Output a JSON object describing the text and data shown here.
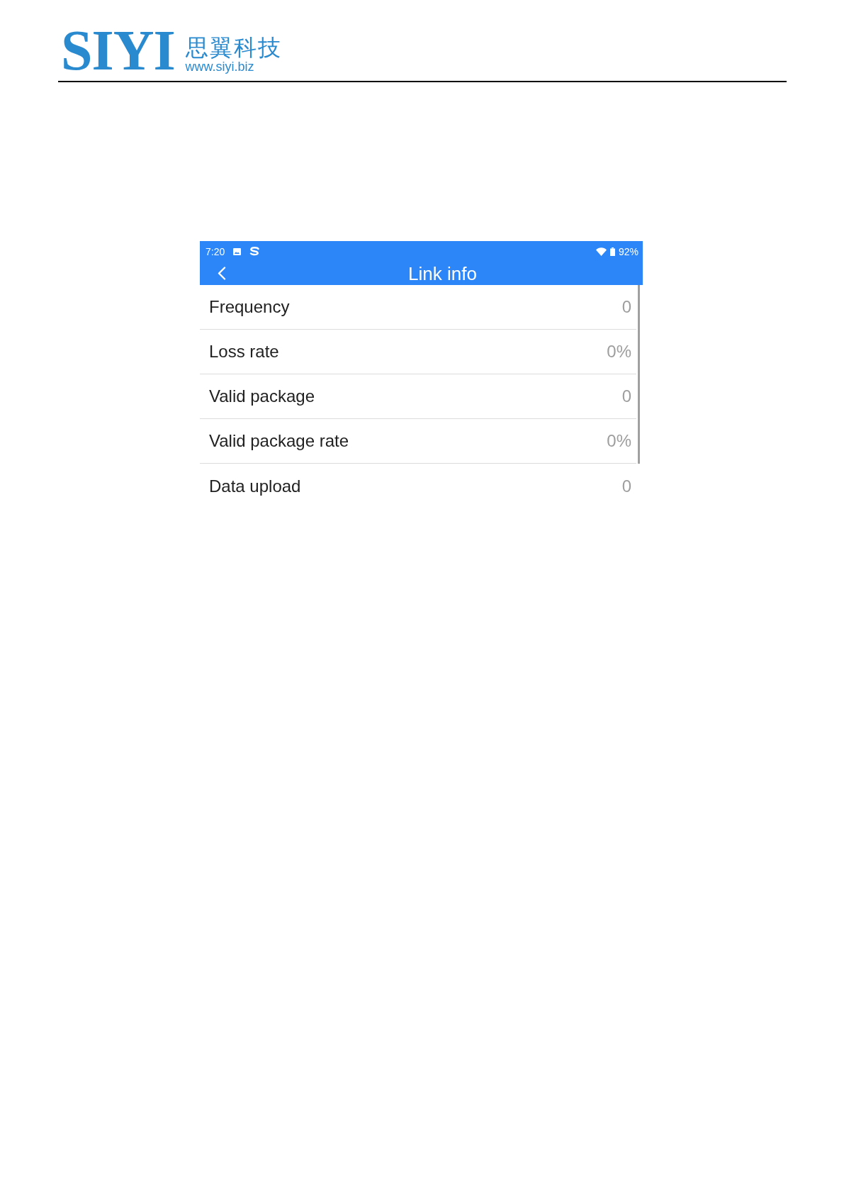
{
  "header": {
    "logo_text": "SIYI",
    "company_name": "思翼科技",
    "website": "www.siyi.biz"
  },
  "status_bar": {
    "time": "7:20",
    "battery": "92%"
  },
  "app_bar": {
    "title": "Link info"
  },
  "rows": [
    {
      "label": "Frequency",
      "value": "0"
    },
    {
      "label": "Loss rate",
      "value": "0%"
    },
    {
      "label": "Valid package",
      "value": "0"
    },
    {
      "label": "Valid package rate",
      "value": "0%"
    },
    {
      "label": "Data upload",
      "value": "0"
    }
  ]
}
